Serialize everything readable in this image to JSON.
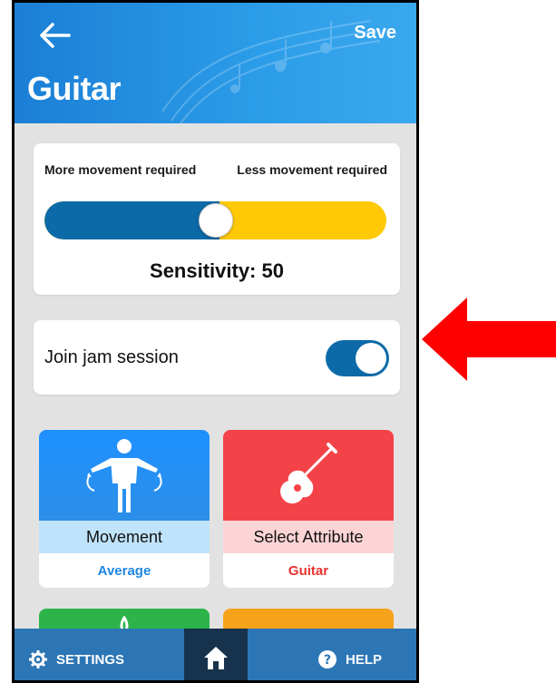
{
  "header": {
    "title": "Guitar",
    "save_label": "Save",
    "back_icon": "arrow-left-icon"
  },
  "sensitivity": {
    "left_label": "More movement required",
    "right_label": "Less movement required",
    "value": 50,
    "display": "Sensitivity: 50",
    "track_left_color": "#0d6aa8",
    "track_right_color": "#ffc907"
  },
  "jam": {
    "label": "Join jam session",
    "enabled": true
  },
  "tiles": [
    {
      "name": "Movement",
      "value": "Average",
      "icon": "person-arms-icon",
      "color": "#1e90ff"
    },
    {
      "name": "Select Attribute",
      "value": "Guitar",
      "icon": "guitar-icon",
      "color": "#f44348"
    }
  ],
  "bottom_nav": {
    "settings_label": "SETTINGS",
    "help_label": "HELP"
  },
  "annotation": {
    "arrow_color": "#ff0000"
  }
}
